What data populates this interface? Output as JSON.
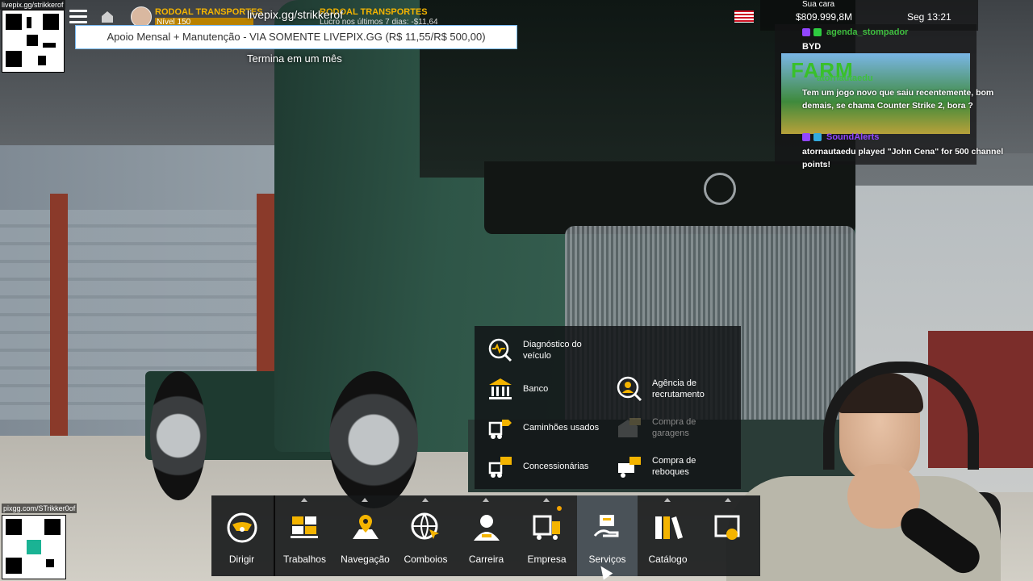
{
  "overlay": {
    "qr_top_label": "livepix.gg/strikkerof",
    "qr_bottom_label": "pixgg.com/STrikker0of",
    "live_top": "livepix.gg/strikkerof",
    "support_banner": "Apoio Mensal + Manutenção - VIA SOMENTE LIVEPIX.GG (R$ 11,55/R$ 500,00)",
    "support_sub": "Termina em um mês"
  },
  "header": {
    "company_1": "RODOAL TRANSPORTES",
    "level": "Nível 150",
    "company_2": "RODOAL TRANSPORTES",
    "profit_text": "Lucro nos últimos 7 dias: -$11,64",
    "balance": "$809.999,8M",
    "datetime": "Seg 13:21",
    "sua_cara": "Sua cara"
  },
  "chat": {
    "user_1": "agenda_stompador",
    "section_label": "BYD",
    "thumb_text": "FARM",
    "user_2": "atornautaedu",
    "msg_1": "Tem um jogo novo que saiu recentemente, bom demais, se chama Counter Strike 2, bora ?",
    "user_3": "SoundAlerts",
    "msg_2": "atornautaedu played \"John Cena\" for 500 channel points!"
  },
  "services_menu": {
    "items": [
      {
        "label": "Diagnóstico do veículo",
        "icon": "diagnostic-icon",
        "enabled": true
      },
      {
        "label": "Banco",
        "icon": "bank-icon",
        "enabled": true
      },
      {
        "label": "Agência de recrutamento",
        "icon": "recruitment-icon",
        "enabled": true
      },
      {
        "label": "Caminhões usados",
        "icon": "used-trucks-icon",
        "enabled": true
      },
      {
        "label": "Compra de garagens",
        "icon": "garage-purchase-icon",
        "enabled": false
      },
      {
        "label": "Concessionárias",
        "icon": "dealers-icon",
        "enabled": true
      },
      {
        "label": "Compra de reboques",
        "icon": "trailer-purchase-icon",
        "enabled": true
      }
    ]
  },
  "bottom_menu": {
    "items": [
      {
        "label": "Dirigir",
        "icon": "steering-wheel-icon"
      },
      {
        "label": "Trabalhos",
        "icon": "cargo-icon"
      },
      {
        "label": "Navegação",
        "icon": "map-pin-icon"
      },
      {
        "label": "Comboios",
        "icon": "globe-cursor-icon"
      },
      {
        "label": "Carreira",
        "icon": "driver-icon"
      },
      {
        "label": "Empresa",
        "icon": "company-icon"
      },
      {
        "label": "Serviços",
        "icon": "services-icon",
        "active": true
      },
      {
        "label": "Catálogo",
        "icon": "catalog-icon"
      },
      {
        "label": "",
        "icon": "photo-mode-icon"
      }
    ]
  },
  "colors": {
    "accent_yellow": "#f4b400",
    "menu_active": "#4a5258",
    "twitch_purple": "#9146ff"
  }
}
